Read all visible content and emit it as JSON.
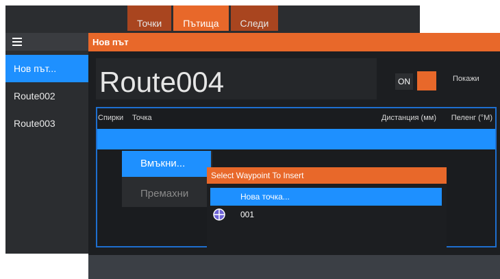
{
  "tabs": [
    {
      "label": "Точки",
      "active": false
    },
    {
      "label": "Пътища",
      "active": true
    },
    {
      "label": "Следи",
      "active": false
    }
  ],
  "route_list": [
    "Нов път...",
    "Route002",
    "Route003"
  ],
  "dialog": {
    "title": "Нов път",
    "route_name": "Route004",
    "toggle_label": "ON",
    "show_label": "Покажи",
    "table_headers": {
      "stops": "Спирки",
      "point": "Точка",
      "distance": "Дистанция (мм)",
      "bearing": "Пеленг (°M)"
    }
  },
  "context_menu": {
    "insert": "Вмъкни...",
    "remove": "Премахни"
  },
  "popup": {
    "title": "Select Waypoint To Insert",
    "items": [
      "Нова точка...",
      "001"
    ]
  },
  "colors": {
    "accent_orange": "#e8682a",
    "selection_blue": "#1e90ff",
    "panel_dark": "#2b2d30"
  }
}
